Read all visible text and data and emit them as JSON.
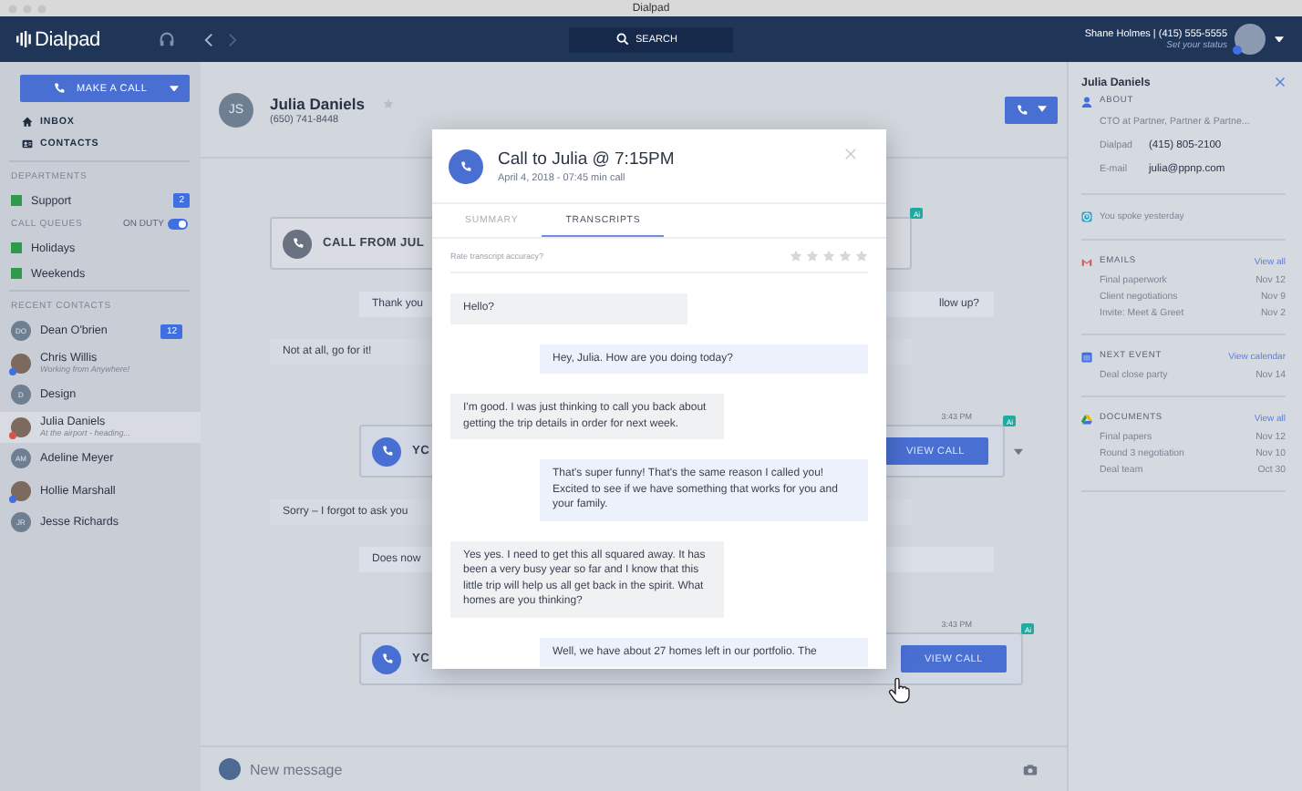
{
  "window": {
    "title": "Dialpad"
  },
  "topbar": {
    "logo": "Dialpad",
    "search": {
      "placeholder": "SEARCH"
    },
    "user": {
      "name": "Shane Holmes | (415) 555-5555",
      "status_prompt": "Set your status",
      "color": "#3f6fe0"
    }
  },
  "sidebar": {
    "make_call": "MAKE A CALL",
    "nav": [
      {
        "kind": "inbox",
        "label": "INBOX"
      },
      {
        "kind": "contacts",
        "label": "CONTACTS"
      }
    ],
    "departments": {
      "heading": "DEPARTMENTS",
      "items": [
        {
          "label": "Support",
          "color": "#2f9a4a",
          "badge": "2"
        }
      ]
    },
    "call_queues": {
      "heading": "CALL QUEUES",
      "duty_label": "ON DUTY",
      "on_duty": true,
      "items": [
        {
          "label": "Holidays",
          "color": "#2f9a4a"
        },
        {
          "label": "Weekends",
          "color": "#2f9a4a"
        }
      ]
    },
    "recent_contacts": {
      "heading": "RECENT CONTACTS",
      "items": [
        {
          "name": "Dean O'brien",
          "kind": "initials",
          "initials": "DO",
          "badge": "12",
          "selected": false
        },
        {
          "name": "Chris Willis",
          "status": "Working from Anywhere!",
          "kind": "photo",
          "color": "#3f6fe0",
          "selected": false
        },
        {
          "name": "Design",
          "kind": "initials",
          "initials": "D",
          "selected": false
        },
        {
          "name": "Julia Daniels",
          "status": "At the airport - heading...",
          "kind": "photo",
          "color": "#d9534f",
          "selected": true
        },
        {
          "name": "Adeline Meyer",
          "kind": "initials",
          "initials": "AM",
          "selected": false
        },
        {
          "name": "Hollie Marshall",
          "kind": "photo",
          "color": "#3f6fe0",
          "selected": false
        },
        {
          "name": "Jesse Richards",
          "kind": "initials",
          "initials": "JR",
          "selected": false
        }
      ]
    }
  },
  "conversation": {
    "contact": {
      "initials": "JS",
      "name": "Julia Daniels",
      "phone": "(650) 741-8448",
      "starred": false
    },
    "items": [
      {
        "kind": "incoming",
        "label": "CALL FROM JUL",
        "badge": "Ai"
      },
      {
        "kind": "sent",
        "start": "Thank you",
        "end": "llow up?"
      },
      {
        "kind": "received",
        "start": "Not at all, go for it!"
      },
      {
        "kind": "outgoing",
        "time": "3:43 PM",
        "badge": "Ai",
        "label": "YC",
        "button": "VIEW CALL",
        "menu": true
      },
      {
        "kind": "received",
        "start": "Sorry – I forgot to ask you"
      },
      {
        "kind": "sent",
        "start": "Does now"
      },
      {
        "kind": "outgoing",
        "time": "3:43 PM",
        "badge": "Ai",
        "label": "YC",
        "button": "VIEW CALL",
        "menu": false
      }
    ],
    "composer": {
      "placeholder": "New message"
    }
  },
  "call_detail": {
    "title": "Call to Julia @ 7:15PM",
    "subtitle": "April 4, 2018 - 07:45 min call",
    "tabs": [
      {
        "label": "SUMMARY",
        "selected": false
      },
      {
        "label": "TRANSCRIPTS",
        "selected": true
      }
    ],
    "rating": {
      "prompt": "Rate transcript accuracy?",
      "stars": 0
    },
    "transcript": [
      {
        "kind": "received",
        "text": "Hello?"
      },
      {
        "kind": "sent",
        "text": "Hey, Julia. How are you doing today?"
      },
      {
        "kind": "received",
        "text": "I'm good. I was just thinking to call you back about getting the trip details in order for next week."
      },
      {
        "kind": "sent",
        "text": "That's super funny! That's the same reason I called you! Excited to see if we have something that works for you and your family."
      },
      {
        "kind": "received",
        "text": "Yes yes. I need to get this all squared away. It has been a very busy year so far and I know that this little trip will help us all get back in the spirit. What homes are you thinking?"
      },
      {
        "kind": "sent",
        "text": "Well, we have about 27 homes left in our portfolio. The"
      }
    ]
  },
  "contact_panel": {
    "name": "Julia Daniels",
    "about": {
      "heading": "ABOUT",
      "title": "CTO at Partner, Partner & Partne...",
      "fields": [
        {
          "label": "Dialpad",
          "value": "(415) 805-2100"
        },
        {
          "label": "E-mail",
          "value": "julia@ppnp.com"
        }
      ]
    },
    "last_contact": "You spoke yesterday",
    "sections": [
      {
        "kind": "emails",
        "heading": "EMAILS",
        "link": "View all",
        "items": [
          {
            "title": "Final paperwork",
            "date": "Nov 12"
          },
          {
            "title": "Client negotiations",
            "date": "Nov 9"
          },
          {
            "title": "Invite: Meet & Greet",
            "date": "Nov 2"
          }
        ]
      },
      {
        "kind": "event",
        "heading": "NEXT EVENT",
        "link": "View calendar",
        "items": [
          {
            "title": "Deal close party",
            "date": "Nov 14"
          }
        ]
      },
      {
        "kind": "documents",
        "heading": "DOCUMENTS",
        "link": "View all",
        "items": [
          {
            "title": "Final papers",
            "date": "Nov 12"
          },
          {
            "title": "Round 3 negotiation",
            "date": "Nov 10"
          },
          {
            "title": "Deal team",
            "date": "Oct 30"
          }
        ]
      }
    ]
  }
}
